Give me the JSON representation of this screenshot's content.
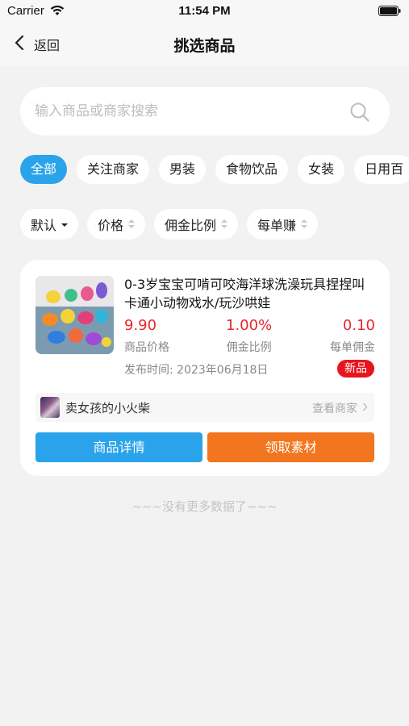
{
  "status_bar": {
    "carrier": "Carrier",
    "time": "11:54 PM"
  },
  "nav": {
    "back_label": "返回",
    "title": "挑选商品"
  },
  "search": {
    "placeholder": "输入商品或商家搜索"
  },
  "categories": [
    "全部",
    "关注商家",
    "男装",
    "食物饮品",
    "女装",
    "日用百"
  ],
  "sort_options": [
    "默认",
    "价格",
    "佣金比例",
    "每单赚"
  ],
  "product": {
    "title": "0-3岁宝宝可啃可咬海洋球洗澡玩具捏捏叫卡通小动物戏水/玩沙哄娃",
    "price": "9.90",
    "price_label": "商品价格",
    "commission_rate": "1.00%",
    "commission_rate_label": "佣金比例",
    "commission": "0.10",
    "commission_label": "每单佣金",
    "publish_time": "发布时间: 2023年06月18日",
    "badge": "新品",
    "merchant_name": "卖女孩的小火柴",
    "view_merchant": "查看商家",
    "detail_button": "商品详情",
    "material_button": "领取素材"
  },
  "footer": {
    "no_more": "~~~没有更多数据了~~~"
  },
  "colors": {
    "accent_blue": "#2aa3ea",
    "accent_orange": "#f2761f",
    "price_red": "#e8262b",
    "badge_red": "#e8141c"
  }
}
